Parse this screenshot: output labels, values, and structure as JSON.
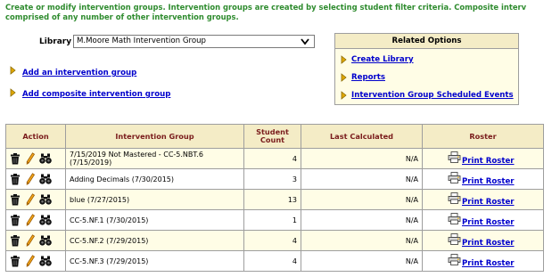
{
  "intro": {
    "line1": "Create or modify intervention groups. Intervention groups are created by selecting student filter criteria. Composite interv",
    "line2": "comprised of any number of other intervention groups."
  },
  "library": {
    "label": "Library",
    "selected": "M.Moore Math Intervention Group"
  },
  "actions": {
    "add_group": "Add an intervention group",
    "add_composite": "Add composite intervention group"
  },
  "related": {
    "title": "Related Options",
    "items": [
      {
        "label": "Create Library"
      },
      {
        "label": "Reports"
      },
      {
        "label": "Intervention Group Scheduled Events"
      }
    ]
  },
  "table": {
    "headers": [
      "Action",
      "Intervention Group",
      "Student Count",
      "Last Calculated",
      "Roster"
    ],
    "roster_link": "Print Roster",
    "rows": [
      {
        "group": "7/15/2019 Not Mastered - CC-5.NBT.6 (7/15/2019)",
        "count": "4",
        "last": "N/A"
      },
      {
        "group": "Adding Decimals (7/30/2015)",
        "count": "3",
        "last": "N/A"
      },
      {
        "group": "blue (7/27/2015)",
        "count": "13",
        "last": "N/A"
      },
      {
        "group": "CC-5.NF.1 (7/30/2015)",
        "count": "1",
        "last": "N/A"
      },
      {
        "group": "CC-5.NF.2 (7/29/2015)",
        "count": "4",
        "last": "N/A"
      },
      {
        "group": "CC-5.NF.3 (7/29/2015)",
        "count": "4",
        "last": "N/A"
      }
    ]
  },
  "colors": {
    "intro_text": "#2e8b2e",
    "header_bg": "#f4ecc6",
    "header_text": "#7a1c1c",
    "odd_row_bg": "#fffde6",
    "link": "#0000cc",
    "arrow": "#e0a800"
  },
  "icons": {
    "delete": "trash-icon",
    "edit": "pencil-icon",
    "view": "binoculars-icon",
    "print": "printer-icon",
    "bullet": "arrow-right-icon",
    "dropdown": "chevron-down-icon"
  }
}
